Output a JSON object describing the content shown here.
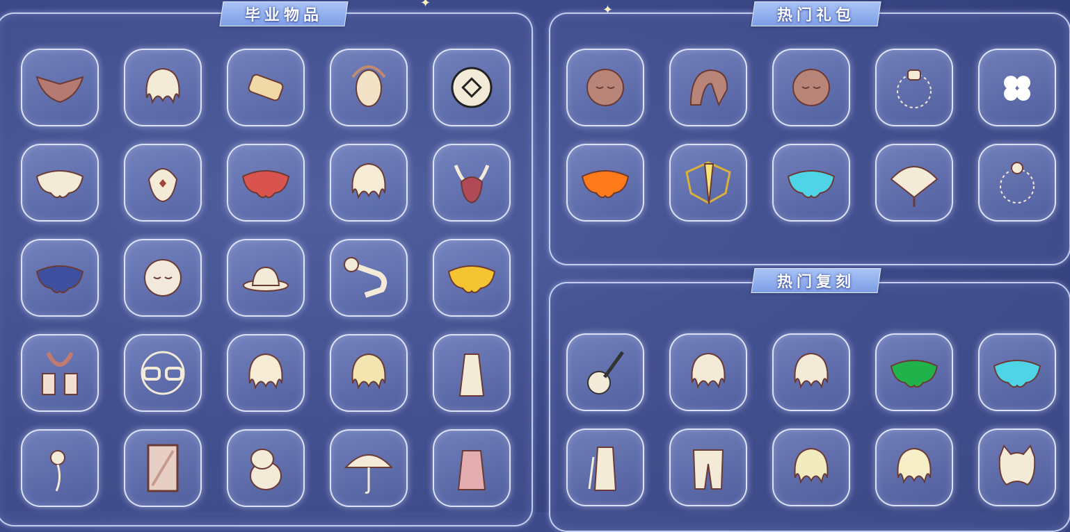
{
  "sections": {
    "graduation": {
      "title": "毕业物品"
    },
    "hot_packs": {
      "title": "热门礼包"
    },
    "hot_reruns": {
      "title": "热门复刻"
    }
  },
  "items": {
    "graduation": [
      "manta-cape-icon",
      "hair-buns-icon",
      "scroll-icon",
      "tribal-mask-icon",
      "round-shield-icon",
      "white-cape-icon",
      "spirit-mask-icon",
      "red-cape-icon",
      "spiky-hair-icon",
      "horned-mask-icon",
      "blue-cape-icon",
      "round-mask-icon",
      "hat-icon",
      "horn-instrument-icon",
      "yellow-cape-icon",
      "scarf-icon",
      "glasses-icon",
      "bun-hair-icon",
      "messy-hair-icon",
      "robe-outfit-icon",
      "flower-icon",
      "card-icon",
      "moomin-prop-icon",
      "umbrella-icon",
      "pink-coat-icon"
    ],
    "hot_packs": [
      "closed-eyes-mask-icon",
      "hood-icon",
      "face-mask-icon",
      "cat-necklace-icon",
      "clover-hairpin-icon",
      "orange-cape-icon",
      "banner-icon",
      "cyan-cape-icon",
      "fan-icon",
      "pearl-necklace-icon"
    ],
    "hot_reruns": [
      "guitar-icon",
      "bob-hair-icon",
      "ponytail-hair-icon",
      "green-cape-icon",
      "cyan-wave-cape-icon",
      "knight-outfit-icon",
      "pants-icon",
      "curly-hair-icon",
      "short-hair-icon",
      "cat-ears-hair-icon"
    ]
  },
  "colors": {
    "background": "#3f4c8c",
    "tab": "#8faaf0",
    "cream": "#f4ead8",
    "outline": "#6a3a34",
    "red_cape": "#d9534f",
    "orange_cape": "#ff7a1a",
    "cyan_cape": "#4fd3e6",
    "green_cape": "#22b24c",
    "yellow_cape": "#f5c432",
    "blue_cape": "#3f4fa0",
    "mauve": "#b98579"
  }
}
